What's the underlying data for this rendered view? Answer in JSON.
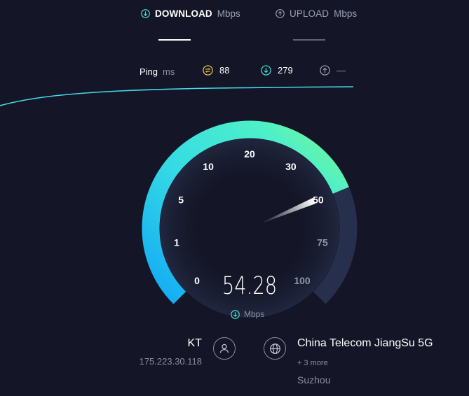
{
  "tabs": {
    "download": {
      "label": "DOWNLOAD",
      "unit": "Mbps"
    },
    "upload": {
      "label": "UPLOAD",
      "unit": "Mbps"
    }
  },
  "ping": {
    "label": "Ping",
    "unit": "ms",
    "jitter_value": "88",
    "download_value": "279",
    "upload_value": "—"
  },
  "gauge": {
    "ticks": [
      "0",
      "1",
      "5",
      "10",
      "20",
      "30",
      "50",
      "75",
      "100"
    ],
    "fraction": 0.75,
    "speed": "54.28",
    "unit": "Mbps",
    "colors": {
      "start": "#1bb1f2",
      "mid": "#3ee3df",
      "end": "#6ef59a",
      "track": "#262f4c"
    }
  },
  "isp": {
    "name": "KT",
    "ip": "175.223.30.118"
  },
  "server": {
    "name": "China Telecom JiangSu 5G",
    "more": "+ 3 more",
    "location": "Suzhou"
  },
  "icons": {
    "download": "download-arrow-icon",
    "upload": "upload-arrow-icon",
    "jitter": "jitter-icon",
    "user": "user-icon",
    "globe": "globe-icon"
  }
}
